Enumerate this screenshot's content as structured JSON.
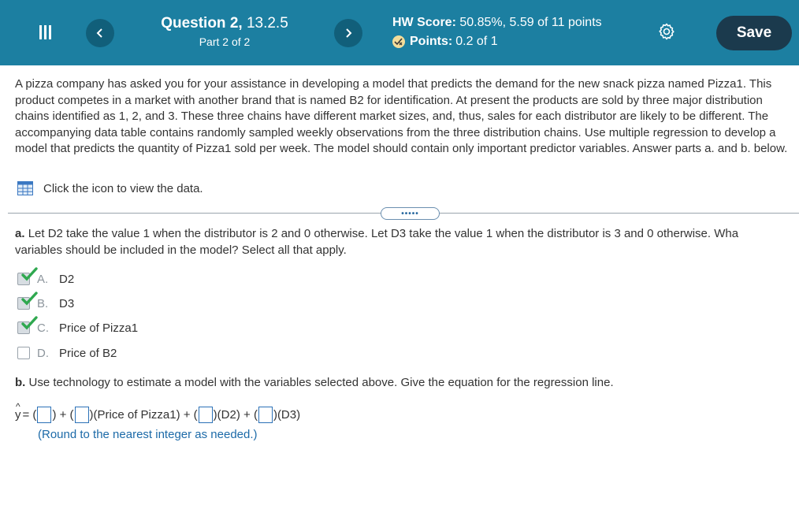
{
  "header": {
    "question_title": "Question 2, 13.2.5",
    "question_title_bold": "Question 2,",
    "question_title_rest": "13.2.5",
    "part_label": "Part 2 of 2",
    "hw_score_label": "HW Score:",
    "hw_score_value": "50.85%, 5.59 of 11 points",
    "points_label": "Points:",
    "points_value": "0.2 of 1",
    "save_label": "Save"
  },
  "problem": {
    "intro": "A pizza company has asked you for your assistance in developing a model that predicts the demand for the new snack pizza named Pizza1. This product competes in a market with another brand that is named B2 for identification. At present the products are sold by three major distribution chains identified as 1, 2, and 3. These three chains have different market sizes, and, thus, sales for each distributor are likely to be different. The accompanying data table contains randomly sampled weekly observations from the three distribution chains. Use multiple regression to develop a model that predicts the quantity of Pizza1 sold per week. The model should contain only important predictor variables. Answer parts a. and b. below.",
    "data_link": "Click the icon to view the data."
  },
  "part_a": {
    "label": "a.",
    "text_line1": "Let D2 take the value 1 when the distributor is 2 and 0 otherwise. Let D3 take the value 1 when the distributor is 3 and 0 otherwise. Wha",
    "text_line2": "variables should be included in the model? Select all that apply.",
    "options": [
      {
        "letter": "A.",
        "text": "D2",
        "checked": true
      },
      {
        "letter": "B.",
        "text": "D3",
        "checked": true
      },
      {
        "letter": "C.",
        "text": "Price of Pizza1",
        "checked": true
      },
      {
        "letter": "D.",
        "text": "Price of B2",
        "checked": false
      }
    ]
  },
  "part_b": {
    "label": "b.",
    "text": "Use technology to estimate a model with the variables selected above. Give the equation for the regression line.",
    "eq_y": "y",
    "eq_hat": "^",
    "eq_equals": "=",
    "term_price": "(Price of Pizza1)",
    "term_d2": "(D2)",
    "term_d3": "(D3)",
    "round_note": "(Round to the nearest integer as needed.)"
  },
  "colors": {
    "header_bg": "#1c7fa1",
    "save_bg": "#1b3a4d",
    "check_green": "#2fa84f",
    "link_blue": "#1c6aa8"
  }
}
